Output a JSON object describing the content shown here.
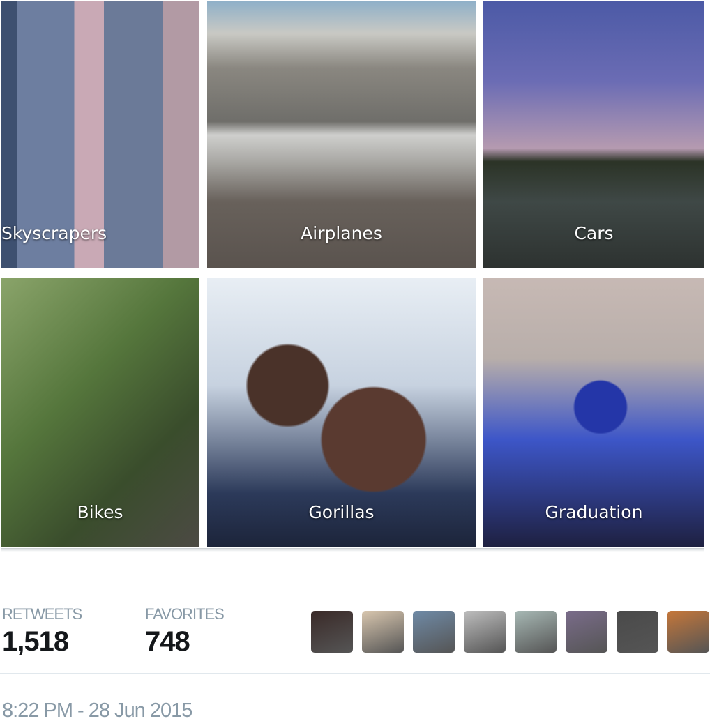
{
  "photo_grid": [
    {
      "label": "Skyscrapers"
    },
    {
      "label": "Airplanes"
    },
    {
      "label": "Cars"
    },
    {
      "label": "Bikes"
    },
    {
      "label": "Gorillas"
    },
    {
      "label": "Graduation"
    }
  ],
  "stats": {
    "retweets_label": "RETWEETS",
    "retweets_value": "1,518",
    "favorites_label": "FAVORITES",
    "favorites_value": "748"
  },
  "avatar_colors": [
    "#3a2a28",
    "#d8c6ae",
    "#6f8aa6",
    "#bdbdbd",
    "#a7b8b4",
    "#7a6c8a",
    "#4a4a4a",
    "#c5773a"
  ],
  "timestamp": "8:22 PM - 28 Jun 2015"
}
